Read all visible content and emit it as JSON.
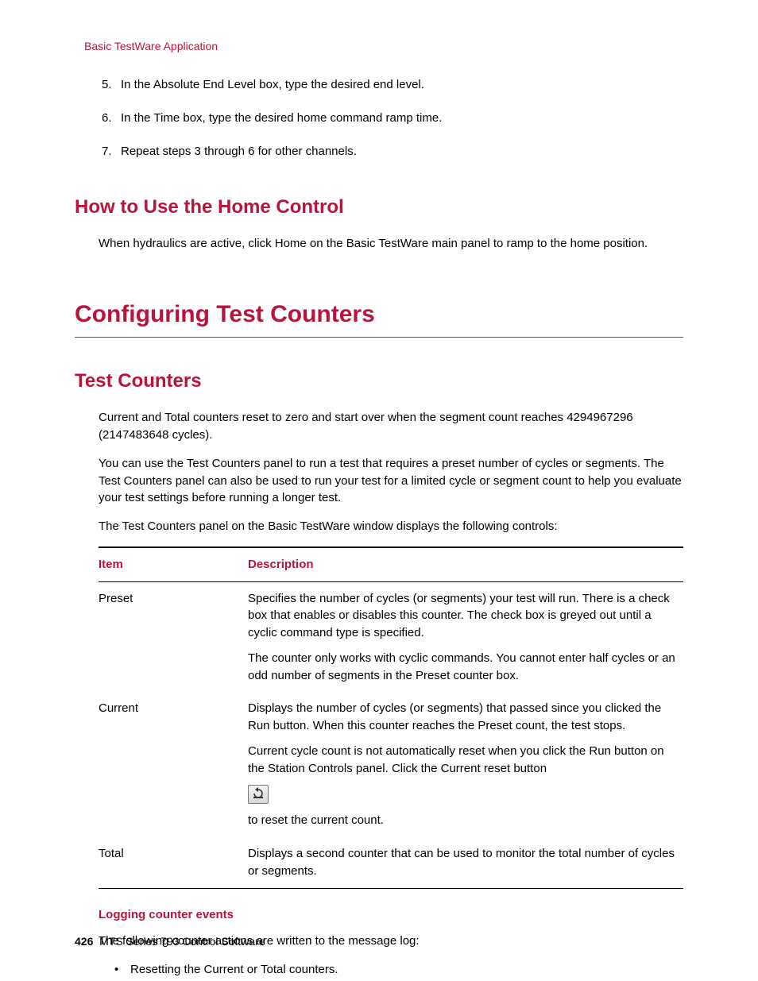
{
  "header_label": "Basic TestWare Application",
  "steps": [
    {
      "n": "5.",
      "t": "In the Absolute End Level box, type the desired end level."
    },
    {
      "n": "6.",
      "t": "In the Time box, type the desired home command ramp time."
    },
    {
      "n": "7.",
      "t": "Repeat steps 3 through 6 for other channels."
    }
  ],
  "h2a": "How to Use the Home Control",
  "h2a_body": "When hydraulics are active, click Home on the Basic TestWare main panel to ramp to the home position.",
  "h1": "Configuring Test Counters",
  "h2b": "Test Counters",
  "tc_p1": "Current and Total counters reset to zero and start over when the segment count reaches 4294967296 (2147483648 cycles).",
  "tc_p2": "You can use the Test Counters panel to run a test that requires a preset number of cycles or segments. The Test Counters panel can also be used to run your test for a limited cycle or segment count to help you evaluate your test settings before running a longer test.",
  "tc_p3": "The Test Counters panel on the Basic TestWare window displays the following controls:",
  "tbl": {
    "th0": "Item",
    "th1": "Description",
    "rows": [
      {
        "item": "Preset",
        "blocks": [
          "Specifies the number of cycles (or segments) your test will run. There is a check box that enables or disables this counter. The check box is greyed out until a cyclic command type is specified.",
          "The counter only works with cyclic commands. You cannot enter half cycles or an odd number of segments in the Preset counter box."
        ]
      },
      {
        "item": "Current",
        "blocks": [
          "Displays the number of cycles (or segments) that passed since you clicked the Run button. When this counter reaches the Preset count, the test stops.",
          "Current cycle count is not automatically reset when you click the Run button on the Station Controls panel. Click the Current reset button",
          "__RESET_ICON__",
          "to reset the current count."
        ]
      },
      {
        "item": "Total",
        "blocks": [
          "Displays a second counter that can be used to monitor the total number of cycles or segments."
        ]
      }
    ]
  },
  "sub_h": "Logging counter events",
  "sub_p": "The following counter actions are written to the message log:",
  "bullets": [
    "Resetting the Current or Total counters."
  ],
  "footer_pn": "426",
  "footer_txt": "MTS Series 793 Control Software"
}
